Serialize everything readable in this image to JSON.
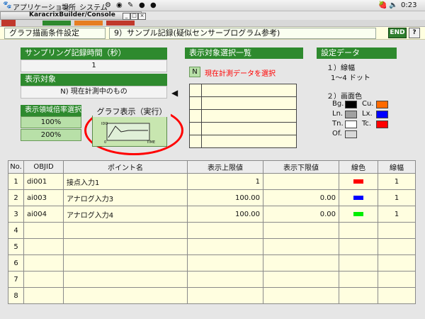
{
  "system_bar": {
    "menu_applications": "アプリケーション",
    "menu_places": "場所",
    "menu_system": "システム",
    "clock": "0:23"
  },
  "window": {
    "title": "KaracrixBuilder/Console",
    "min_glyph": "_",
    "max_glyph": "□",
    "close_glyph": "×"
  },
  "header": {
    "screen_name": "グラフ描画条件設定",
    "record_title": "9）サンプル記録(疑似センサープログラム参考)",
    "end_label": "END",
    "help_label": "?"
  },
  "sampling": {
    "label": "サンプリング記録時間（秒）",
    "value": "1"
  },
  "display_target": {
    "label": "表示対象",
    "value": "N) 現在計測中のもの"
  },
  "zoom": {
    "label": "表示領域倍率選択",
    "options": [
      "100%",
      "200%"
    ],
    "selected": "100%"
  },
  "graph_button": {
    "label": "グラフ表示（実行）",
    "axis_y": "IDO",
    "axis_origin": "0",
    "axis_x": "TIME"
  },
  "target_list": {
    "title": "表示対象選択一覧",
    "btn_label": "N",
    "action_text": "現在計測データを選択",
    "rows": 5
  },
  "settings": {
    "title": "設定データ",
    "line_width_label": "１）線幅",
    "line_width_value": "1〜4 ドット",
    "color_label": "２）画面色",
    "items": [
      {
        "name": "Bg.",
        "color": "#000000"
      },
      {
        "name": "Cu.",
        "color": "#ff6a00"
      },
      {
        "name": "Ln.",
        "color": "#a0a0a0"
      },
      {
        "name": "Lx.",
        "color": "#0000ff"
      },
      {
        "name": "Tn.",
        "color": "#ffffff"
      },
      {
        "name": "Tc.",
        "color": "#ff0000"
      },
      {
        "name": "Of.",
        "color": "#d8d8d8"
      }
    ]
  },
  "table": {
    "headers": [
      "No.",
      "OBJID",
      "ポイント名",
      "表示上限値",
      "表示下限値",
      "線色",
      "線幅"
    ],
    "rows": [
      {
        "no": "1",
        "objid": "di001",
        "name": "接点入力1",
        "upper": "1",
        "lower": "",
        "color": "#ff0000",
        "width": "1"
      },
      {
        "no": "2",
        "objid": "ai003",
        "name": "アナログ入力3",
        "upper": "100.00",
        "lower": "0.00",
        "color": "#0000ff",
        "width": "1"
      },
      {
        "no": "3",
        "objid": "ai004",
        "name": "アナログ入力4",
        "upper": "100.00",
        "lower": "0.00",
        "color": "#00ee00",
        "width": "1"
      },
      {
        "no": "4",
        "objid": "",
        "name": "",
        "upper": "",
        "lower": "",
        "color": "",
        "width": ""
      },
      {
        "no": "5",
        "objid": "",
        "name": "",
        "upper": "",
        "lower": "",
        "color": "",
        "width": ""
      },
      {
        "no": "6",
        "objid": "",
        "name": "",
        "upper": "",
        "lower": "",
        "color": "",
        "width": ""
      },
      {
        "no": "7",
        "objid": "",
        "name": "",
        "upper": "",
        "lower": "",
        "color": "",
        "width": ""
      },
      {
        "no": "8",
        "objid": "",
        "name": "",
        "upper": "",
        "lower": "",
        "color": "",
        "width": ""
      }
    ]
  }
}
